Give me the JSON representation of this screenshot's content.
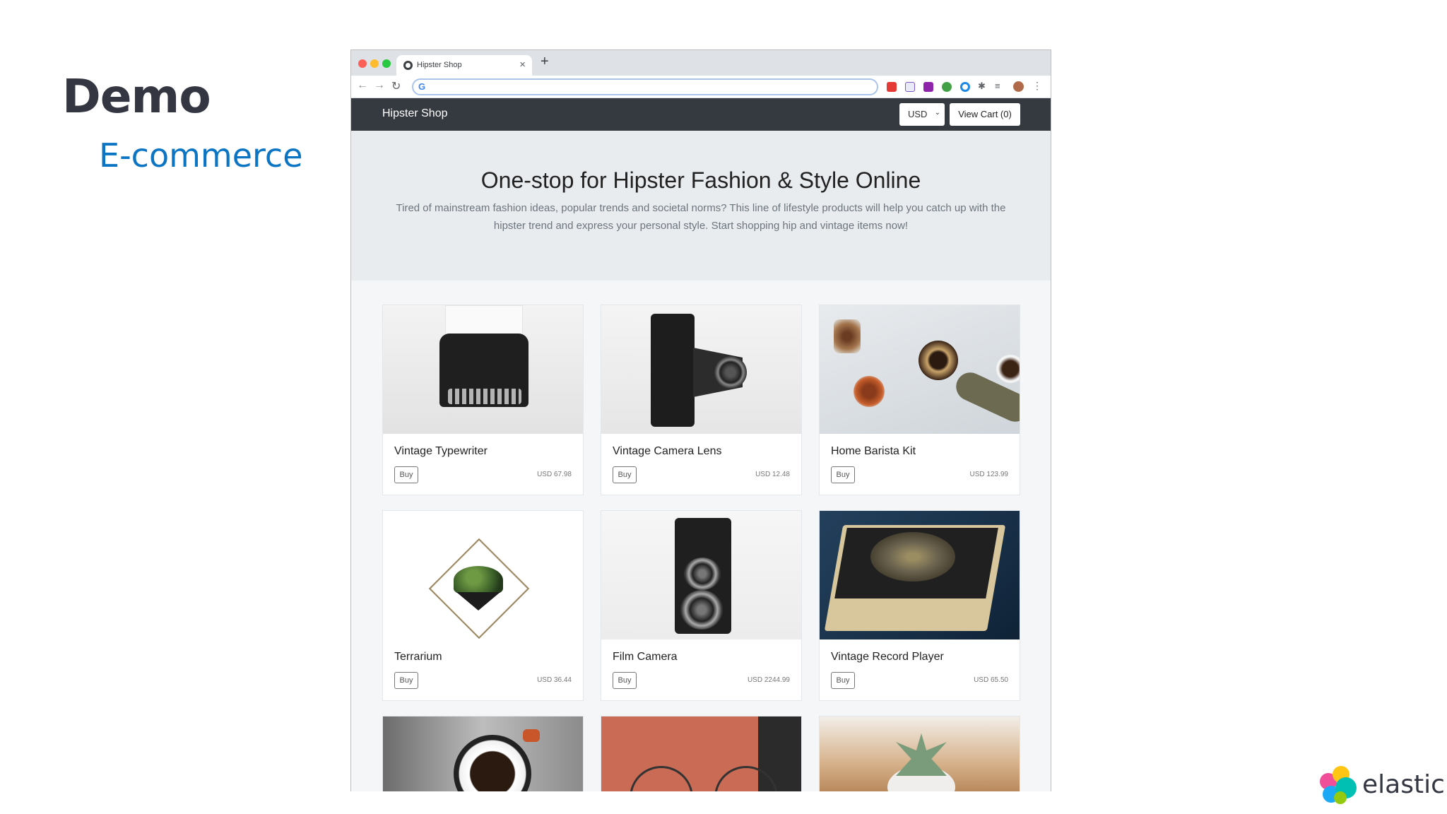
{
  "slide": {
    "title": "Demo",
    "subtitle": "E-commerce",
    "footer_brand": "elastic"
  },
  "browser": {
    "tab_title": "Hipster Shop",
    "tab_close": "×",
    "new_tab": "+",
    "address_icon": "G",
    "address_value": "",
    "nav_icons": [
      "arrow-left-icon",
      "arrow-right-icon",
      "reload-icon"
    ],
    "extension_icons": [
      "extension-red-icon",
      "extension-whatfont-icon",
      "extension-purple-icon",
      "extension-green-icon",
      "extension-blue-ring-icon",
      "puzzle-icon",
      "reading-list-icon"
    ],
    "menu": "⋮"
  },
  "shop": {
    "brand": "Hipster Shop",
    "currency": "USD",
    "view_cart": "View Cart (0)",
    "hero": {
      "title": "One-stop for Hipster Fashion & Style Online",
      "text": "Tired of mainstream fashion ideas, popular trends and societal norms? This line of lifestyle products will help you catch up with the hipster trend and express your personal style. Start shopping hip and vintage items now!"
    },
    "buy_label": "Buy",
    "products": [
      {
        "name": "Vintage Typewriter",
        "price": "USD 67.98"
      },
      {
        "name": "Vintage Camera Lens",
        "price": "USD 12.48"
      },
      {
        "name": "Home Barista Kit",
        "price": "USD 123.99"
      },
      {
        "name": "Terrarium",
        "price": "USD 36.44"
      },
      {
        "name": "Film Camera",
        "price": "USD 2244.99"
      },
      {
        "name": "Vintage Record Player",
        "price": "USD 65.50"
      }
    ]
  },
  "colors": {
    "header_bg": "#343a40",
    "hero_bg": "#e9ecef",
    "subtitle_blue": "#0b75c4"
  }
}
